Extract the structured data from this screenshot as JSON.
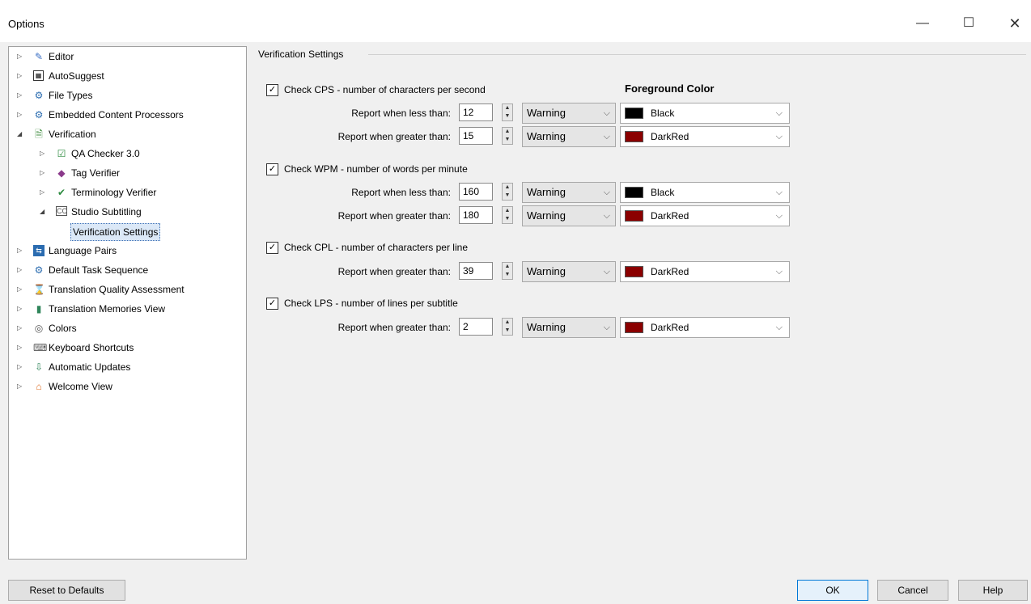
{
  "window": {
    "title": "Options",
    "min_glyph": "—",
    "max_glyph": "☐",
    "close_glyph": "✕"
  },
  "tree": {
    "items": [
      {
        "label": "Editor",
        "icon": "pencil-icon"
      },
      {
        "label": "AutoSuggest",
        "icon": "autosuggest-icon"
      },
      {
        "label": "File Types",
        "icon": "file-types-icon"
      },
      {
        "label": "Embedded Content Processors",
        "icon": "gear-icon"
      },
      {
        "label": "Verification",
        "icon": "verification-icon"
      },
      {
        "label": "QA Checker 3.0",
        "icon": "qa-checker-icon"
      },
      {
        "label": "Tag Verifier",
        "icon": "tag-icon"
      },
      {
        "label": "Terminology Verifier",
        "icon": "terminology-check-icon"
      },
      {
        "label": "Studio Subtitling",
        "icon": "subtitle-icon"
      },
      {
        "label": "Verification Settings",
        "icon": ""
      },
      {
        "label": "Language Pairs",
        "icon": "language-pairs-icon"
      },
      {
        "label": "Default Task Sequence",
        "icon": "task-sequence-icon"
      },
      {
        "label": "Translation Quality Assessment",
        "icon": "quality-assessment-icon"
      },
      {
        "label": "Translation Memories View",
        "icon": "translation-memory-icon"
      },
      {
        "label": "Colors",
        "icon": "palette-icon"
      },
      {
        "label": "Keyboard Shortcuts",
        "icon": "keyboard-icon"
      },
      {
        "label": "Automatic Updates",
        "icon": "update-icon"
      },
      {
        "label": "Welcome View",
        "icon": "home-icon"
      }
    ]
  },
  "settings": {
    "group_title": "Verification Settings",
    "foreground_header": "Foreground Color",
    "cps": {
      "checked": true,
      "label": "Check CPS - number of characters per second",
      "rows": [
        {
          "label": "Report when less than:",
          "value": "12",
          "severity": "Warning",
          "color_name": "Black",
          "color_hex": "#000000"
        },
        {
          "label": "Report when greater than:",
          "value": "15",
          "severity": "Warning",
          "color_name": "DarkRed",
          "color_hex": "#8b0000"
        }
      ]
    },
    "wpm": {
      "checked": true,
      "label": "Check WPM - number of words per minute",
      "rows": [
        {
          "label": "Report when less than:",
          "value": "160",
          "severity": "Warning",
          "color_name": "Black",
          "color_hex": "#000000"
        },
        {
          "label": "Report when greater than:",
          "value": "180",
          "severity": "Warning",
          "color_name": "DarkRed",
          "color_hex": "#8b0000"
        }
      ]
    },
    "cpl": {
      "checked": true,
      "label": "Check CPL - number of characters per line",
      "rows": [
        {
          "label": "Report when greater than:",
          "value": "39",
          "severity": "Warning",
          "color_name": "DarkRed",
          "color_hex": "#8b0000"
        }
      ]
    },
    "lps": {
      "checked": true,
      "label": "Check LPS - number of lines per subtitle",
      "rows": [
        {
          "label": "Report when greater than:",
          "value": "2",
          "severity": "Warning",
          "color_name": "DarkRed",
          "color_hex": "#8b0000"
        }
      ]
    }
  },
  "footer": {
    "reset_label": "Reset to Defaults",
    "ok_label": "OK",
    "cancel_label": "Cancel",
    "help_label": "Help"
  }
}
